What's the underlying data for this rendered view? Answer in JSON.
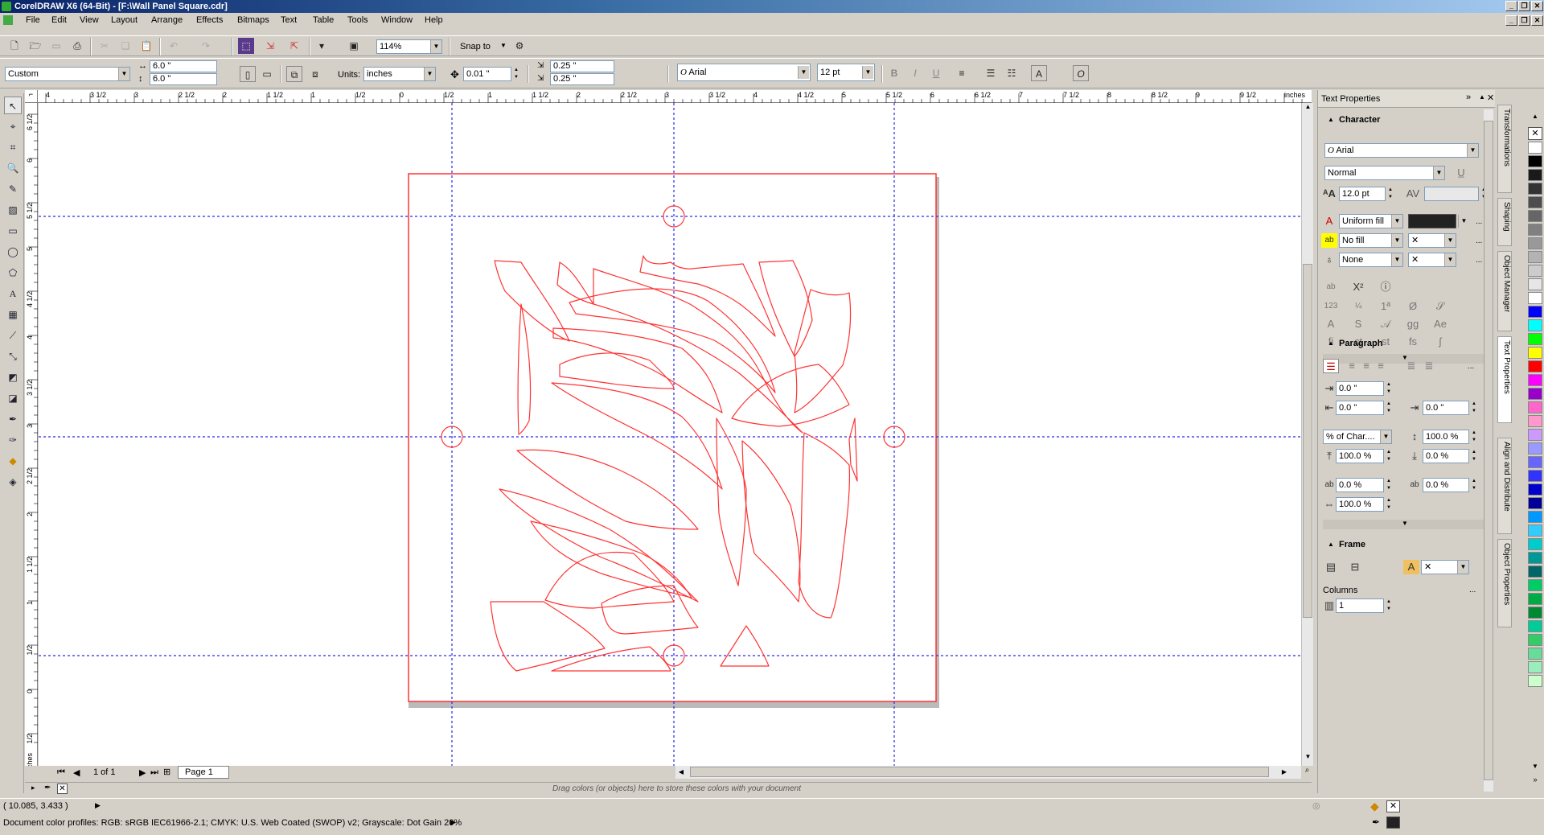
{
  "window": {
    "title": "CorelDRAW X6 (64-Bit) - [F:\\Wall Panel Square.cdr]"
  },
  "menu": [
    "File",
    "Edit",
    "View",
    "Layout",
    "Arrange",
    "Effects",
    "Bitmaps",
    "Text",
    "Table",
    "Tools",
    "Window",
    "Help"
  ],
  "standard_toolbar": {
    "zoom": "114%",
    "snap_to": "Snap to"
  },
  "property_bar": {
    "paper_preset": "Custom",
    "width": "6.0 \"",
    "height": "6.0 \"",
    "units_label": "Units:",
    "units": "inches",
    "nudge": "0.01 \"",
    "dup_x": "0.25 \"",
    "dup_y": "0.25 \"",
    "font": "Arial",
    "font_size": "12 pt"
  },
  "ruler": {
    "unit": "inches",
    "h_labels": [
      "4",
      "3 1/2",
      "3",
      "2 1/2",
      "2",
      "1 1/2",
      "1",
      "1/2",
      "0",
      "1/2",
      "1",
      "1 1/2",
      "2",
      "2 1/2",
      "3",
      "3 1/2",
      "4",
      "4 1/2",
      "5",
      "5 1/2",
      "6",
      "6 1/2",
      "7",
      "7 1/2",
      "8",
      "8 1/2",
      "9",
      "9 1/2",
      "inches"
    ],
    "v_labels": [
      "6 1/2",
      "6",
      "5 1/2",
      "5",
      "4 1/2",
      "4",
      "3 1/2",
      "3",
      "2 1/2",
      "2",
      "1 1/2",
      "1",
      "1/2",
      "0",
      "1/2"
    ]
  },
  "page_nav": {
    "count": "1 of 1",
    "tab": "Page 1"
  },
  "palette_bar": {
    "hint": "Drag colors (or objects) here to store these colors with your document"
  },
  "status": {
    "coords": "( 10.085, 3.433 )",
    "profiles": "Document color profiles: RGB: sRGB IEC61966-2.1; CMYK: U.S. Web Coated (SWOP) v2; Grayscale: Dot Gain 20%"
  },
  "docker": {
    "title": "Text Properties",
    "character": {
      "heading": "Character",
      "font": "Arial",
      "style": "Normal",
      "size": "12.0 pt",
      "fill_type": "Uniform fill",
      "bg_fill": "No fill",
      "outline": "None"
    },
    "paragraph": {
      "heading": "Paragraph",
      "indent_first": "0.0 \"",
      "indent_left": "0.0 \"",
      "indent_right": "0.0 \"",
      "spacing_unit": "% of Char....",
      "line_spacing": "100.0 %",
      "before_para": "100.0 %",
      "after_para": "0.0 %",
      "char_spacing": "0.0 %",
      "word_spacing": "0.0 %",
      "language_spacing": "100.0 %"
    },
    "frame": {
      "heading": "Frame",
      "columns_label": "Columns",
      "columns": "1"
    }
  },
  "side_tabs": [
    "Transformations",
    "Shaping",
    "Object Manager",
    "Text Properties",
    "Align and Distribute",
    "Object Properties"
  ],
  "colors": {
    "accent": "#0a246a",
    "guide": "#2020e0",
    "artwork": "#e02020",
    "palette": [
      "#ffffff",
      "#000000",
      "#1a1a1a",
      "#333333",
      "#4d4d4d",
      "#666666",
      "#808080",
      "#999999",
      "#b3b3b3",
      "#cccccc",
      "#e6e6e6",
      "#ffffff",
      "#0000ff",
      "#00ffff",
      "#00ff00",
      "#ffff00",
      "#ff0000",
      "#ff00ff",
      "#9900cc",
      "#ff66cc",
      "#ff99cc",
      "#cc99ff",
      "#9999ff",
      "#6666ff",
      "#3333ff",
      "#0000cc",
      "#000099",
      "#0099ff",
      "#33ccff",
      "#00cccc",
      "#009999",
      "#006666",
      "#00cc66",
      "#00aa44",
      "#008833",
      "#00cc99",
      "#33cc66",
      "#66dd99",
      "#99eebb",
      "#ccffcc"
    ]
  }
}
